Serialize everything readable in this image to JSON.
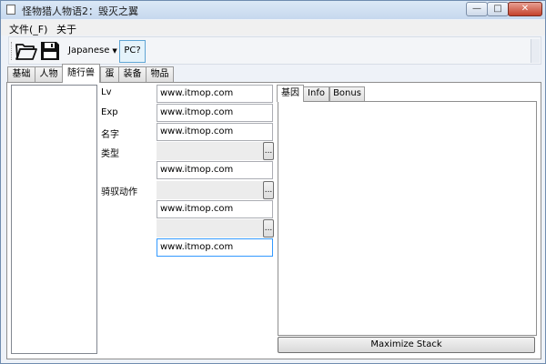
{
  "window": {
    "title": "怪物猎人物语2：毁灭之翼"
  },
  "menu": {
    "items": [
      "文件(_F)",
      "关于"
    ]
  },
  "toolbar": {
    "language": "Japanese",
    "pc_toggle": "PC?"
  },
  "tabs": [
    "基础",
    "人物",
    "随行兽",
    "蛋",
    "装备",
    "物品"
  ],
  "active_tab": "随行兽",
  "fields": {
    "lv_label": "Lv",
    "lv_value": "www.itmop.com",
    "exp_label": "Exp",
    "exp_value": "www.itmop.com",
    "name_label": "名字",
    "name_value": "www.itmop.com",
    "type_label": "类型",
    "type_value": "www.itmop.com",
    "ride_label": "骑驭动作",
    "ride_value": "www.itmop.com",
    "last_value": "www.itmop.com",
    "ellipsis": "..."
  },
  "subtabs": [
    "基因",
    "Info",
    "Bonus"
  ],
  "active_subtab": "基因",
  "maximize_button": "Maximize Stack",
  "caption": {
    "min": "—",
    "max": "□",
    "close": "✕"
  }
}
